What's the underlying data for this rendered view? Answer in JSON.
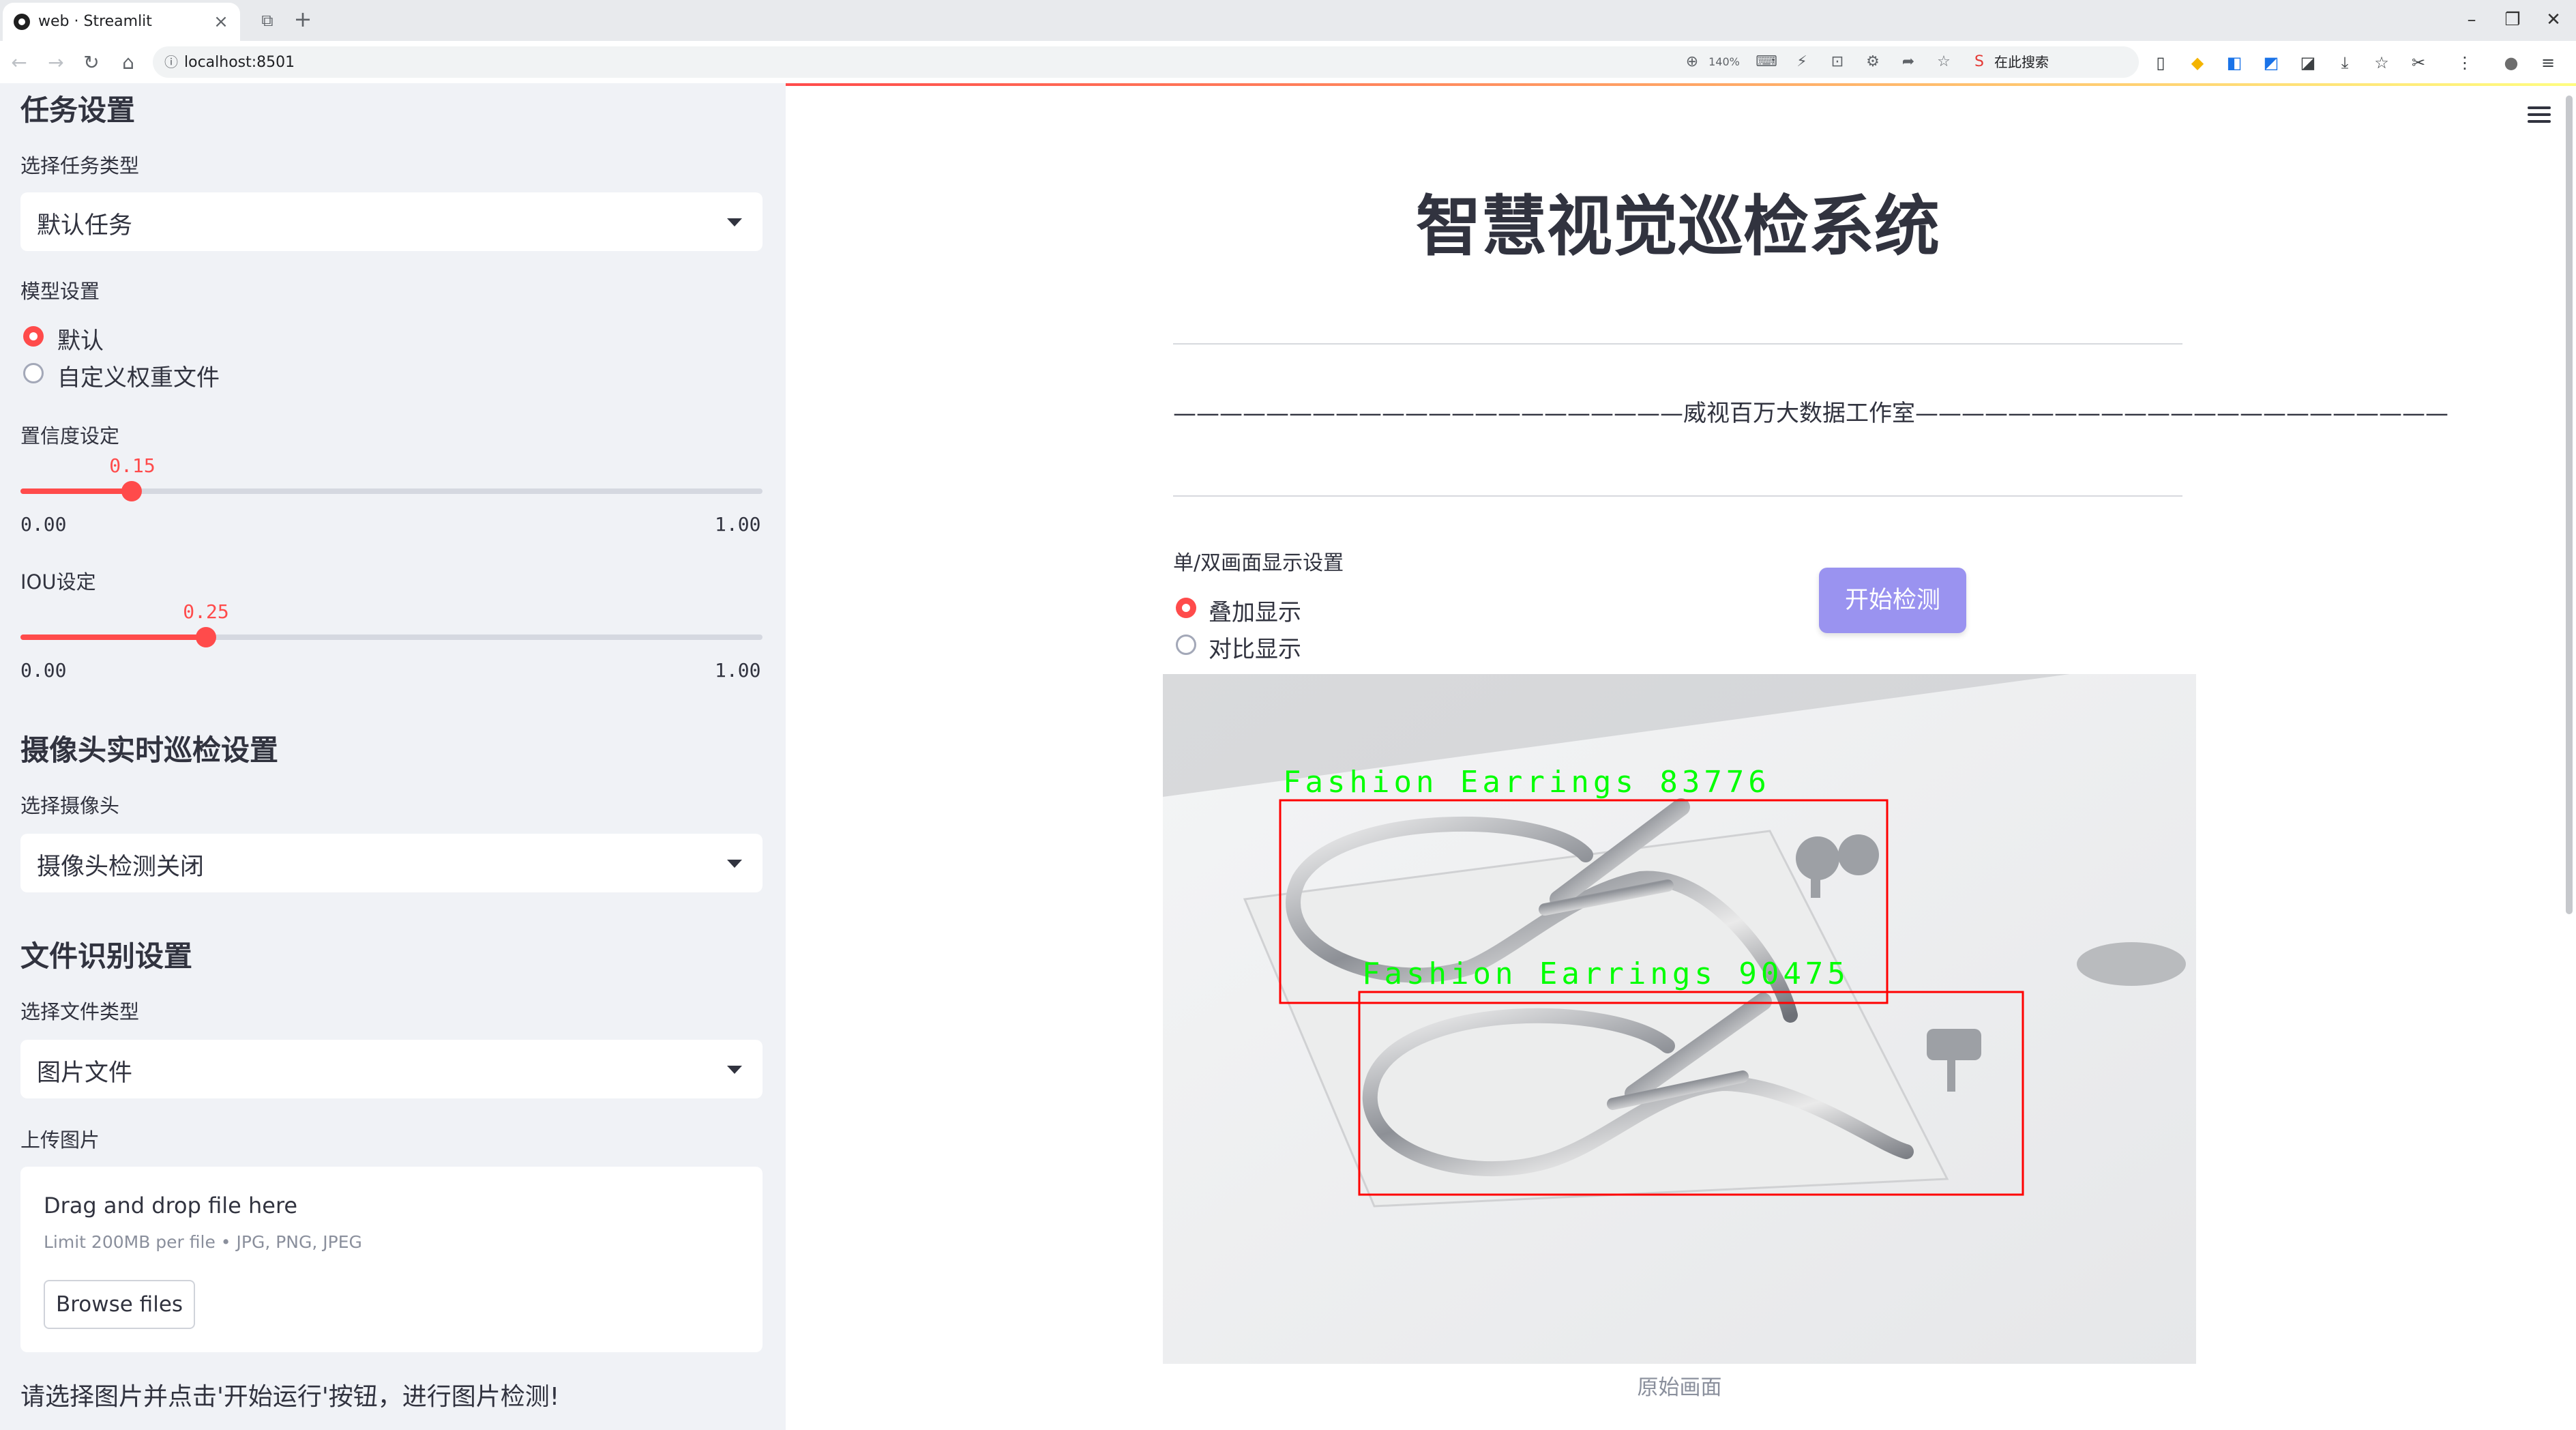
{
  "browser": {
    "tab_title": "web · Streamlit",
    "close_glyph": "×",
    "tab_extra_glyph": "⧉",
    "new_tab_glyph": "+",
    "window_controls": [
      "–",
      "❐",
      "✕"
    ],
    "nav": [
      "←",
      "→",
      "↻",
      "⌂"
    ],
    "info_glyph": "ⓘ",
    "url": "localhost:8501",
    "zoom_icon": "⊕",
    "zoom": "140%",
    "search_placeholder": "在此搜索",
    "search_engine_glyph": "S",
    "toolbar_glyphs": [
      "▯",
      "◆",
      "◧",
      "◩",
      "◪",
      "⤓",
      "☆",
      "✂",
      "⋮",
      "●",
      "≡"
    ]
  },
  "sidebar": {
    "task_section_title": "任务设置",
    "task_type_label": "选择任务类型",
    "task_type_value": "默认任务",
    "model_label": "模型设置",
    "model_options": [
      "默认",
      "自定义权重文件"
    ],
    "model_selected": 0,
    "confidence_label": "置信度设定",
    "confidence_value": "0.15",
    "confidence_min": "0.00",
    "confidence_max": "1.00",
    "iou_label": "IOU设定",
    "iou_value": "0.25",
    "iou_min": "0.00",
    "iou_max": "1.00",
    "camera_section_title": "摄像头实时巡检设置",
    "camera_label": "选择摄像头",
    "camera_value": "摄像头检测关闭",
    "file_section_title": "文件识别设置",
    "file_type_label": "选择文件类型",
    "file_type_value": "图片文件",
    "upload_label": "上传图片",
    "drop_text": "Drag and drop file here",
    "drop_limit": "Limit 200MB per file • JPG, PNG, JPEG",
    "browse_label": "Browse files",
    "hint": "请选择图片并点击'开始运行'按钮，进行图片检测!"
  },
  "main": {
    "title": "智慧视觉巡检系统",
    "subtitle": "——————————————————————威视百万大数据工作室———————————————————————",
    "display_label": "单/双画面显示设置",
    "display_options": [
      "叠加显示",
      "对比显示"
    ],
    "display_selected": 0,
    "start_button": "开始检测",
    "detections": [
      {
        "label": "Fashion Earrings 83776"
      },
      {
        "label": "Fashion Earrings 90475"
      }
    ],
    "image_caption": "原始画面"
  },
  "colors": {
    "accent": "#ff4b4b",
    "start_button": "#9a93f0",
    "detection_box": "#ff0000",
    "detection_text": "#00ff00",
    "sidebar_bg": "#f0f2f6"
  }
}
